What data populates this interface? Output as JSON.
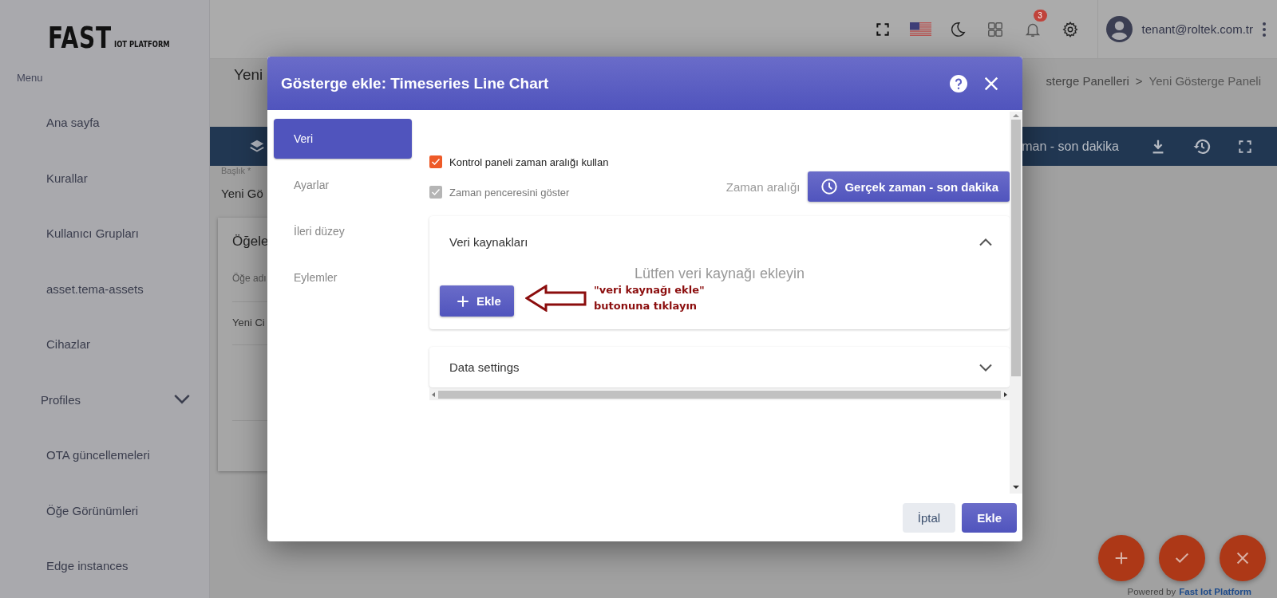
{
  "logo": {
    "title": "FAST",
    "subtitle": "IOT PLATFORM"
  },
  "sidebar": {
    "heading": "Menu",
    "items": [
      {
        "label": "Ana sayfa",
        "kind": "link"
      },
      {
        "label": "Kurallar",
        "kind": "link"
      },
      {
        "label": "Kullanıcı Grupları",
        "kind": "link"
      },
      {
        "label": "asset.tema-assets",
        "kind": "link"
      },
      {
        "label": "Cihazlar",
        "kind": "link"
      },
      {
        "label": "Profiles",
        "kind": "group",
        "expanded": false
      },
      {
        "label": "OTA güncellemeleri",
        "kind": "link"
      },
      {
        "label": "Öğe Görünümleri",
        "kind": "link"
      },
      {
        "label": "Edge instances",
        "kind": "link"
      }
    ]
  },
  "header": {
    "notifications": "3",
    "user": "tenant@roltek.com.tr"
  },
  "page": {
    "title": "Yeni",
    "breadcrumb": [
      "sterge Panelleri",
      "Yeni Gösterge Paneli"
    ],
    "separator": ">",
    "toolbar_text": "man - son dakika",
    "field_label": "Başlık *",
    "field_value": "Yeni Gö",
    "card_title": "Öğele",
    "column": "Öğe adı",
    "row": "Yeni Ci"
  },
  "dialog": {
    "title": "Gösterge ekle: Timeseries Line Chart",
    "tabs": [
      {
        "label": "Veri",
        "selected": true
      },
      {
        "label": "Ayarlar",
        "selected": false
      },
      {
        "label": "İleri düzey",
        "selected": false
      },
      {
        "label": "Eylemler",
        "selected": false
      }
    ],
    "checkboxes": [
      {
        "label": "Kontrol paneli zaman aralığı kullan",
        "checked": true,
        "disabled": false
      },
      {
        "label": "Zaman penceresini göster",
        "checked": true,
        "disabled": true
      }
    ],
    "timewindow": {
      "label": "Zaman aralığı",
      "button": "Gerçek zaman - son dakika"
    },
    "panels": [
      {
        "title": "Veri kaynakları",
        "expanded": true,
        "empty_text": "Lütfen veri kaynağı ekleyin",
        "add_button": "Ekle"
      },
      {
        "title": "Data settings",
        "expanded": false
      }
    ],
    "buttons": [
      {
        "label": "İptal",
        "kind": "secondary"
      },
      {
        "label": "Ekle",
        "kind": "primary"
      }
    ]
  },
  "annotation": {
    "lines": [
      "\"veri kaynağı ekle\"",
      "butonuna tıklayın"
    ]
  },
  "fabs": [
    {
      "kind": "add"
    },
    {
      "kind": "check"
    },
    {
      "kind": "close"
    }
  ],
  "footer": {
    "prefix": "Powered by",
    "link": "Fast Iot Platform"
  }
}
